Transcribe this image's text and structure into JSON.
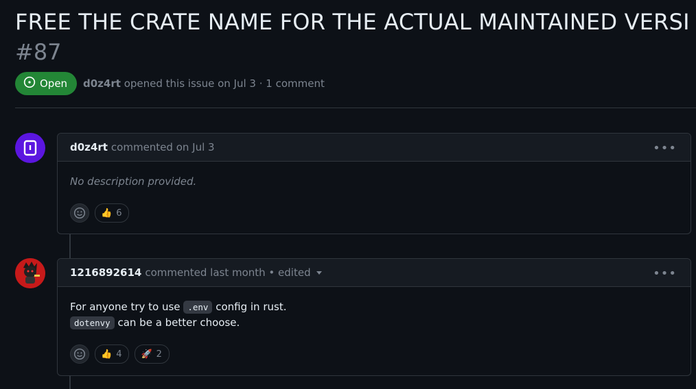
{
  "issue": {
    "title": "FREE THE CRATE NAME FOR THE ACTUAL MAINTAINED VERSI",
    "number": "#87",
    "state": "Open",
    "author": "d0z4rt",
    "meta_text": "opened this issue on Jul 3 · 1 comment"
  },
  "comments": [
    {
      "author": "d0z4rt",
      "time": "commented on Jul 3",
      "body_empty": "No description provided.",
      "reactions": [
        {
          "icon": "thumbs-up",
          "emoji": "👍",
          "count": "6"
        }
      ]
    },
    {
      "author": "1216892614",
      "time": "commented last month • edited",
      "body_line1_pre": "For anyone try to use",
      "body_line1_code": ".env",
      "body_line1_post": "config in rust.",
      "body_line2_code": "dotenvy",
      "body_line2_post": "can be a better choose.",
      "reactions": [
        {
          "icon": "thumbs-up",
          "emoji": "👍",
          "count": "4"
        },
        {
          "icon": "rocket",
          "emoji": "🚀",
          "count": "2"
        }
      ]
    }
  ],
  "colors": {
    "open_green": "#238636",
    "background": "#0d1117",
    "border": "#30363d"
  }
}
